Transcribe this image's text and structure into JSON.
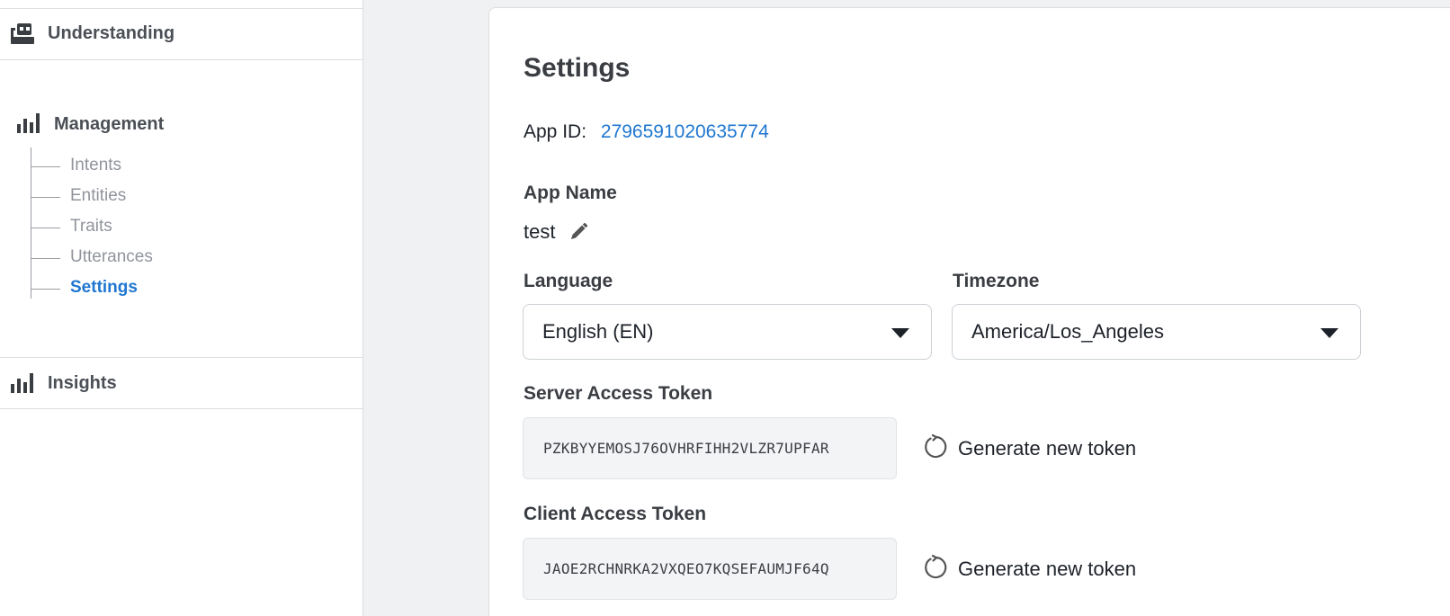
{
  "sidebar": {
    "understanding": {
      "label": "Understanding",
      "icon": "robot-icon"
    },
    "management": {
      "label": "Management",
      "icon": "bar-chart-icon"
    },
    "subnav": [
      {
        "label": "Intents",
        "active": false
      },
      {
        "label": "Entities",
        "active": false
      },
      {
        "label": "Traits",
        "active": false
      },
      {
        "label": "Utterances",
        "active": false
      },
      {
        "label": "Settings",
        "active": true
      }
    ],
    "insights": {
      "label": "Insights",
      "icon": "bar-chart-icon"
    }
  },
  "settings": {
    "title": "Settings",
    "app_id_label": "App ID:",
    "app_id_value": "2796591020635774",
    "app_name_label": "App Name",
    "app_name_value": "test",
    "language_label": "Language",
    "language_value": "English (EN)",
    "timezone_label": "Timezone",
    "timezone_value": "America/Los_Angeles",
    "server_token_label": "Server Access Token",
    "server_token_value": "PZKBYYEMOSJ76OVHRFIHH2VLZR7UPFAR",
    "client_token_label": "Client Access Token",
    "client_token_value": "JAOE2RCHNRKA2VXQEO7KQSEFAUMJF64Q",
    "generate_label": "Generate new token"
  },
  "colors": {
    "accent": "#1f77d0",
    "sidebar_text": "#4b4f56",
    "muted_text": "#90949c",
    "token_bg": "#f3f4f6"
  }
}
